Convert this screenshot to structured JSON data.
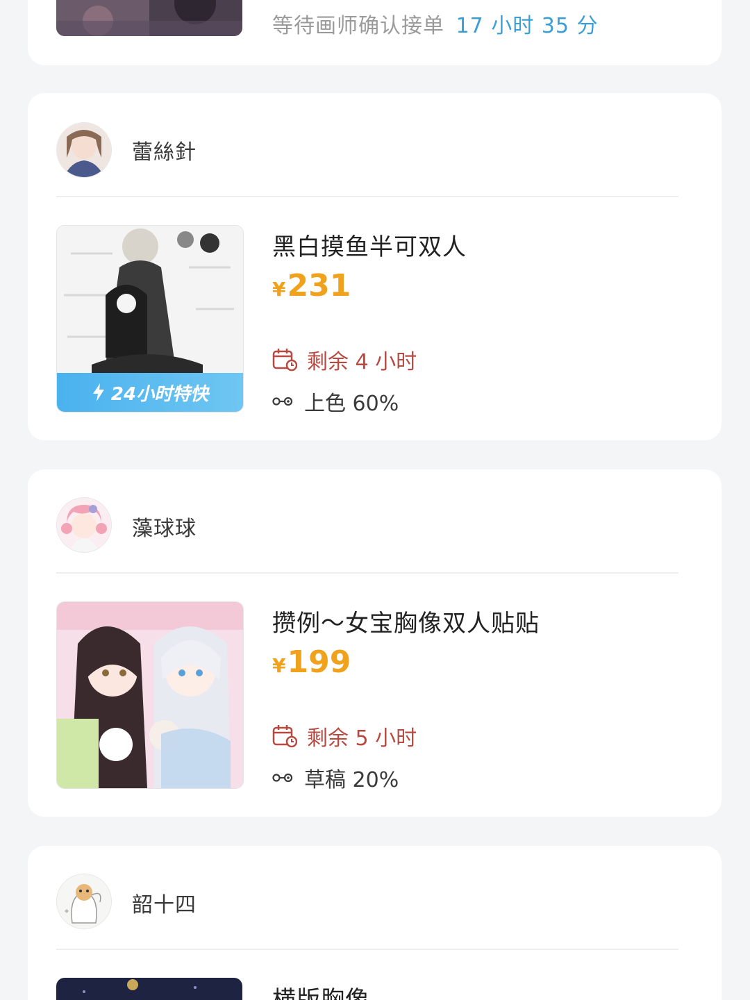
{
  "top_card": {
    "status_prefix": "等待画师确认接单",
    "status_time": "17 小时 35 分"
  },
  "orders": [
    {
      "artist": "蕾絲針",
      "title": "黑白摸鱼半可双人",
      "currency": "¥",
      "price": "231",
      "remaining": "剩余 4 小时",
      "stage": "上色 60%",
      "badge": "24小时特快"
    },
    {
      "artist": "藻球球",
      "title": "攒例～女宝胸像双人贴贴",
      "currency": "¥",
      "price": "199",
      "remaining": "剩余 5 小时",
      "stage": "草稿 20%"
    },
    {
      "artist": "韶十四",
      "title": "横版胸像"
    }
  ],
  "colors": {
    "price": "#f0a21d",
    "remaining": "#b74a40",
    "countdown": "#3a9fd6",
    "badge": "#4ab2ee"
  },
  "icons": [
    "calendar-clock-icon",
    "progress-link-icon",
    "lightning-icon"
  ]
}
